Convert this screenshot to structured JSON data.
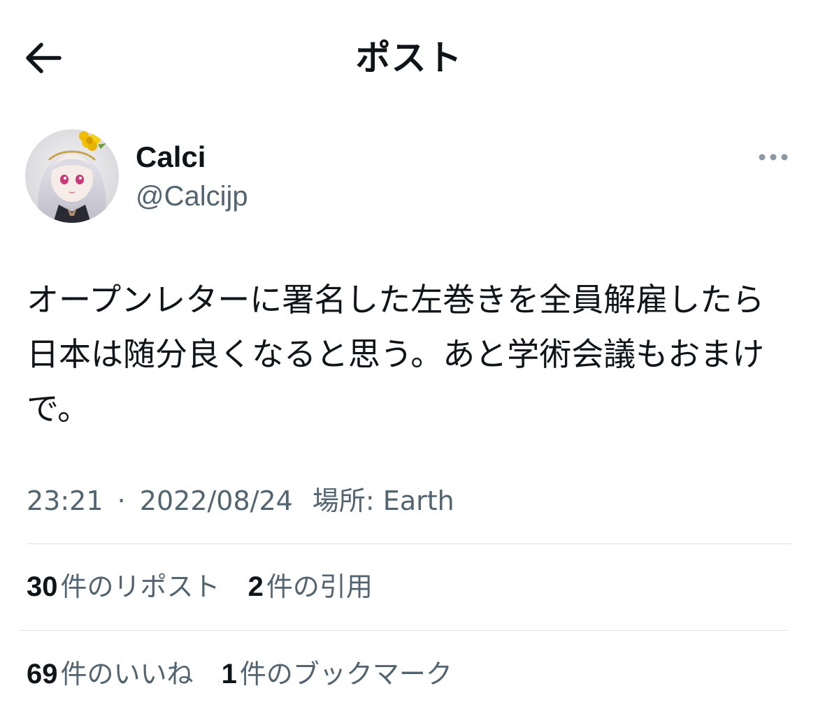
{
  "header": {
    "title": "ポスト",
    "back_icon": "arrow-left-icon"
  },
  "author": {
    "display_name": "Calci",
    "handle": "@Calcijp",
    "more_icon": "more-horizontal-icon"
  },
  "post": {
    "text": "オープンレターに署名した左巻きを全員解雇したら日本は随分良くなると思う。あと学術会議もおまけで。"
  },
  "meta": {
    "time": "23:21",
    "separator": "·",
    "date": "2022/08/24",
    "location": "場所: Earth"
  },
  "stats": {
    "reposts_count": "30",
    "reposts_label": "件のリポスト",
    "quotes_count": "2",
    "quotes_label": "件の引用",
    "likes_count": "69",
    "likes_label": "件のいいね",
    "bookmarks_count": "1",
    "bookmarks_label": "件のブックマーク"
  },
  "colors": {
    "text_primary": "#0f1419",
    "text_secondary": "#536471",
    "divider": "#dfe3e6",
    "more_dots": "#8b98a5"
  }
}
